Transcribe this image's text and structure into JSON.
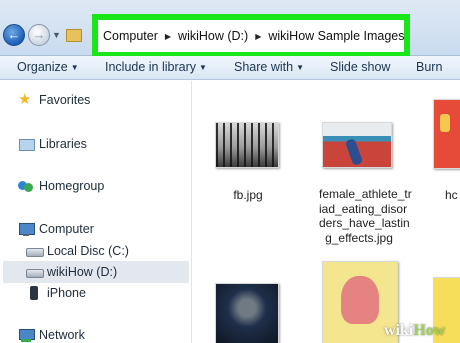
{
  "breadcrumb": [
    "Computer",
    "wikiHow (D:)",
    "wikiHow Sample Images"
  ],
  "toolbar": {
    "organize": "Organize",
    "include_in_library": "Include in library",
    "share_with": "Share with",
    "slide_show": "Slide show",
    "burn": "Burn"
  },
  "sidebar": {
    "favorites": "Favorites",
    "libraries": "Libraries",
    "homegroup": "Homegroup",
    "computer": "Computer",
    "local_disc": "Local Disc (C:)",
    "wikihow_drive": "wikiHow (D:)",
    "iphone": "iPhone",
    "network": "Network"
  },
  "files": [
    {
      "name": "fb.jpg"
    },
    {
      "name_lines": [
        "female_athlete_tr",
        "iad_eating_disor",
        "ders_have_lastin",
        "g_effects.jpg"
      ]
    },
    {
      "name": "hc"
    }
  ],
  "watermark": {
    "wiki": "wiki",
    "how": "How"
  },
  "colors": {
    "highlight_border": "#19e619",
    "toolbar_text": "#1b3550",
    "selected_bg": "#e3e8ee"
  }
}
